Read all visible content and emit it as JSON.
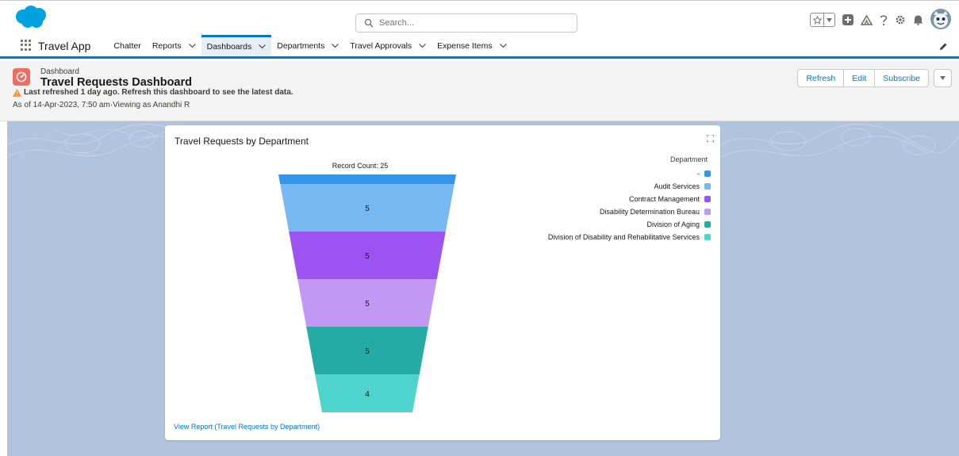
{
  "header": {
    "search_placeholder": "Search...",
    "brand_color": "#00a1e0"
  },
  "nav": {
    "app_name": "Travel App",
    "items": [
      {
        "label": "Chatter",
        "has_menu": false,
        "active": false
      },
      {
        "label": "Reports",
        "has_menu": true,
        "active": false
      },
      {
        "label": "Dashboards",
        "has_menu": true,
        "active": true
      },
      {
        "label": "Departments",
        "has_menu": true,
        "active": false
      },
      {
        "label": "Travel Approvals",
        "has_menu": true,
        "active": false
      },
      {
        "label": "Expense Items",
        "has_menu": true,
        "active": false
      }
    ]
  },
  "page_header": {
    "type_label": "Dashboard",
    "title": "Travel Requests Dashboard",
    "warning": "Last refreshed 1 day ago. Refresh this dashboard to see the latest data.",
    "as_of": "As of 14-Apr-2023, 7:50 am·Viewing as Anandhi R",
    "buttons": {
      "refresh": "Refresh",
      "edit": "Edit",
      "subscribe": "Subscribe"
    }
  },
  "widget": {
    "title": "Travel Requests by Department",
    "view_report": "View Report (Travel Requests by Department)"
  },
  "chart_data": {
    "type": "funnel",
    "title": "Travel Requests by Department",
    "total_label": "Record Count: 25",
    "legend_title": "Department",
    "legend_position": "right",
    "categories": [
      "-",
      "Audit Services",
      "Contract Management",
      "Disability Determination Bureau",
      "Division of Aging",
      "Division of Disability and Rehabilitative Services"
    ],
    "values": [
      1,
      5,
      5,
      5,
      5,
      4
    ],
    "colors": [
      "#3296ed",
      "#77b9f2",
      "#9d53f2",
      "#c398f5",
      "#26aba4",
      "#4ed4cd"
    ],
    "data_labels": [
      "",
      "5",
      "5",
      "5",
      "5",
      "4"
    ]
  }
}
